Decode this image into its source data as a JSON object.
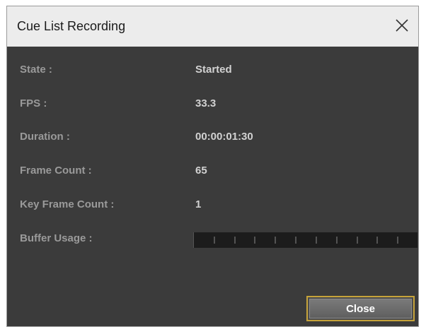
{
  "window": {
    "title": "Cue List Recording",
    "close_icon": "close-icon"
  },
  "fields": [
    {
      "label": "State :",
      "value": "Started"
    },
    {
      "label": "FPS :",
      "value": "33.3"
    },
    {
      "label": "Duration :",
      "value": "00:00:01:30"
    },
    {
      "label": "Frame Count :",
      "value": "65"
    },
    {
      "label": "Key Frame Count :",
      "value": "1"
    }
  ],
  "buffer": {
    "label": "Buffer Usage :",
    "usage_fraction": 0,
    "tick_count": 10
  },
  "buttons": {
    "close_label": "Close"
  },
  "colors": {
    "accent_border": "#c6a33a",
    "panel_bg": "#3b3b3b",
    "title_bg": "#ececec"
  }
}
